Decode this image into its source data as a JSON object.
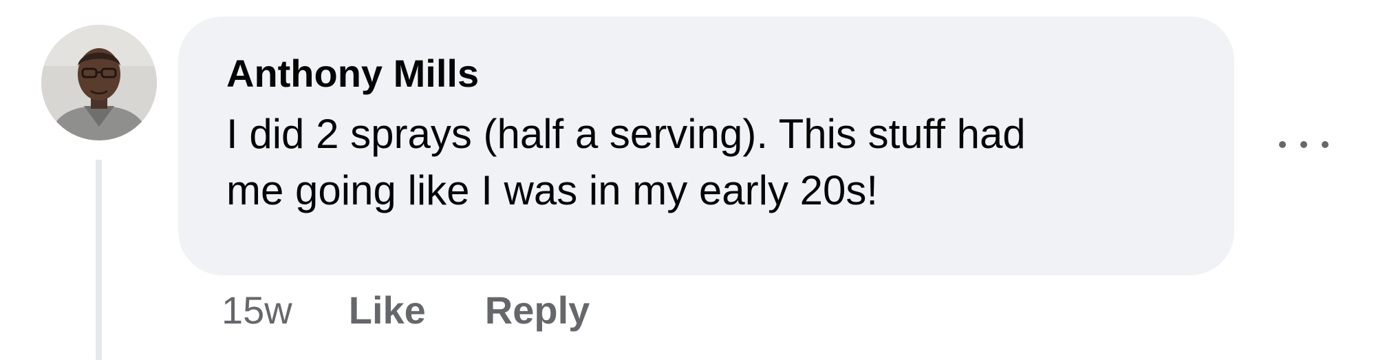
{
  "comment": {
    "author_name": "Anthony Mills",
    "text_lines": [
      "I did 2 sprays (half a serving). This stuff had",
      "me going like I was in my early 20s!"
    ],
    "timestamp": "15w",
    "actions": {
      "like_label": "Like",
      "reply_label": "Reply"
    },
    "more_options_icon": "more-horizontal-icon",
    "avatar_icon": "profile-photo"
  },
  "colors": {
    "bubble_background": "#f0f2f5",
    "primary_text": "#050505",
    "secondary_text": "#65676b",
    "thread_line": "#e6e8eb"
  }
}
